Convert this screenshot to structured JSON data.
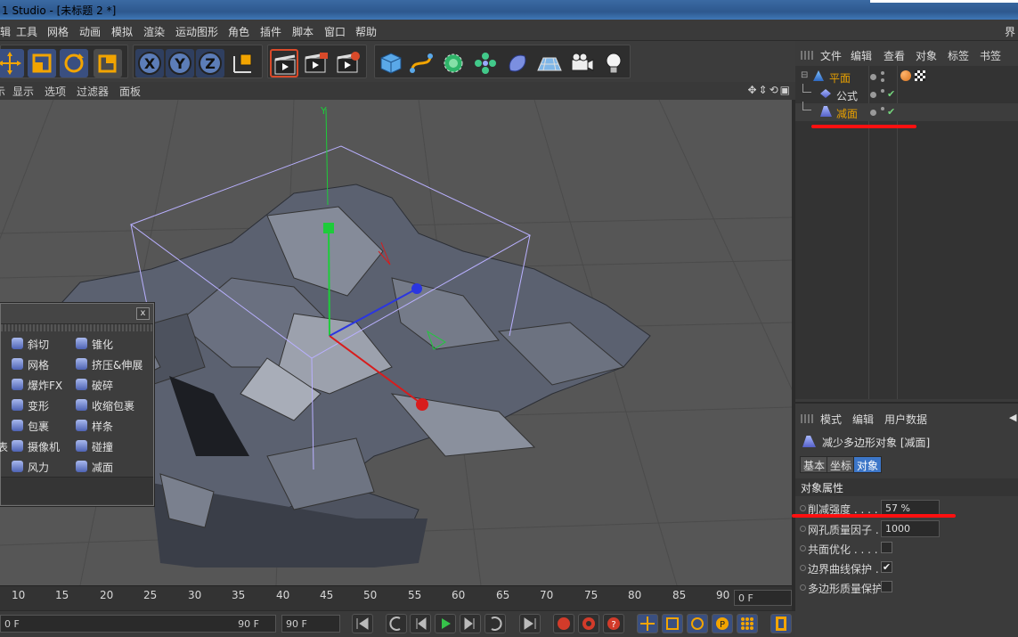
{
  "window": {
    "title": "1 Studio - [未标题 2 *]"
  },
  "menubar": {
    "items": [
      "辑",
      "工具",
      "网格",
      "动画",
      "模拟",
      "渲染",
      "运动图形",
      "角色",
      "插件",
      "脚本",
      "窗口",
      "帮助"
    ],
    "right_label": "界"
  },
  "toolbar": {
    "groups": [
      "transform",
      "axis-lock",
      "render",
      "create"
    ],
    "buttons": [
      "move-icon",
      "scale-icon",
      "rotate-icon",
      "coordinates-icon",
      "x-axis-icon",
      "y-axis-icon",
      "z-axis-icon",
      "world-coord-icon",
      "render-view-icon",
      "render-picture-icon",
      "render-settings-icon",
      "cube-icon",
      "spline-icon",
      "nurbs-icon",
      "array-icon",
      "deformer-icon",
      "floor-icon",
      "camera-icon",
      "light-icon"
    ]
  },
  "viewport": {
    "menu": [
      "示",
      "显示",
      "选项",
      "过滤器",
      "面板"
    ],
    "axis_label_y": "Y"
  },
  "palette": {
    "close_label": "x",
    "items": [
      {
        "label": "斜切",
        "icon": "bevel-icon"
      },
      {
        "label": "锥化",
        "icon": "taper-icon"
      },
      {
        "label": "网格",
        "icon": "mesh-icon"
      },
      {
        "label": "挤压&伸展",
        "icon": "squash-stretch-icon"
      },
      {
        "label": "爆炸FX",
        "icon": "explosion-fx-icon"
      },
      {
        "label": "破碎",
        "icon": "shatter-icon"
      },
      {
        "label": "变形",
        "icon": "morph-icon"
      },
      {
        "label": "收缩包裹",
        "icon": "shrink-wrap-icon"
      },
      {
        "label": "包裹",
        "icon": "wrap-icon"
      },
      {
        "label": "样条",
        "icon": "spline-deformer-icon"
      },
      {
        "label": "摄像机",
        "icon": "camera-deformer-icon"
      },
      {
        "label": "碰撞",
        "icon": "collision-icon"
      },
      {
        "label": "风力",
        "icon": "wind-icon"
      },
      {
        "label": "减面",
        "icon": "polygon-reduction-icon"
      }
    ],
    "left_clip": "表"
  },
  "timeline": {
    "ticks": [
      "10",
      "15",
      "20",
      "25",
      "30",
      "35",
      "40",
      "45",
      "50",
      "55",
      "60",
      "65",
      "70",
      "75",
      "80",
      "85",
      "90"
    ],
    "current_frame": "0 F"
  },
  "transport": {
    "start_field": "0 F",
    "range_end_field": "90 F",
    "end_field": "90 F"
  },
  "objects_panel": {
    "menu": [
      "文件",
      "编辑",
      "查看",
      "对象",
      "标签",
      "书签"
    ],
    "objects": [
      {
        "name": "平面",
        "color": "#e8a000",
        "icon": "plane-icon"
      },
      {
        "name": "公式",
        "color": "#dddddd",
        "icon": "formula-icon"
      },
      {
        "name": "减面",
        "color": "#e8a000",
        "icon": "polygon-reduction-icon"
      }
    ]
  },
  "attributes": {
    "menu": [
      "模式",
      "编辑",
      "用户数据"
    ],
    "object_title": "减少多边形对象 [减面]",
    "tabs": [
      "基本",
      "坐标",
      "对象"
    ],
    "selected_tab": "对象",
    "section": "对象属性",
    "properties": [
      {
        "label": "削减强度 . . . . .",
        "value": "57 %",
        "type": "number"
      },
      {
        "label": "网孔质量因子 . .",
        "value": "1000",
        "type": "number"
      },
      {
        "label": "共面优化 . . . . .",
        "value": "",
        "type": "checkbox"
      },
      {
        "label": "边界曲线保护 . .",
        "value": "✔",
        "type": "checkbox"
      },
      {
        "label": "多边形质量保护",
        "value": "",
        "type": "checkbox"
      }
    ]
  },
  "colors": {
    "accent_selected": "#3c76c8",
    "annotation": "#ff1010",
    "active_object": "#e8a000"
  }
}
